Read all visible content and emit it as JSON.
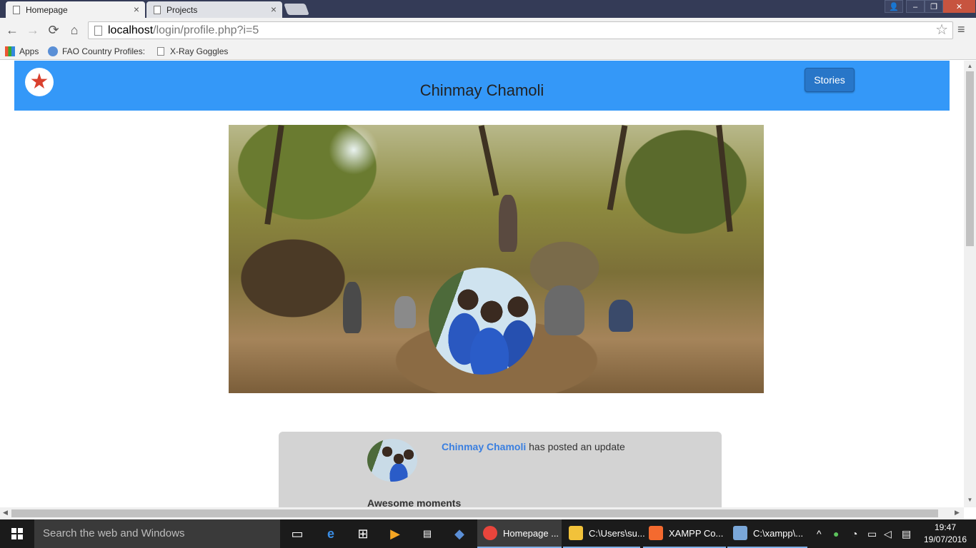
{
  "browser": {
    "tabs": [
      {
        "label": "Homepage",
        "close": "×"
      },
      {
        "label": "Projects",
        "close": "×"
      }
    ],
    "window_controls": {
      "user": "👤",
      "minimize": "–",
      "restore": "❐",
      "close": "✕"
    },
    "nav": {
      "back": "←",
      "forward": "→",
      "reload": "⟳",
      "home": "⌂"
    },
    "url": {
      "host": "localhost",
      "path": "/login/profile.php?i=5"
    },
    "star": "☆",
    "menu": "≡",
    "bookmarks": [
      {
        "label": "Apps",
        "icon": "apps-icon"
      },
      {
        "label": "FAO Country Profiles:",
        "icon": "globe-icon"
      },
      {
        "label": "X-Ray Goggles",
        "icon": "page-icon"
      }
    ]
  },
  "site": {
    "logo_glyph": "★",
    "title": "Chinmay Chamoli",
    "nav_button": "Stories"
  },
  "post": {
    "author": "Chinmay Chamoli",
    "action": "has posted an update",
    "title": "Awesome moments"
  },
  "scrollbars": {
    "up": "▲",
    "down": "▼",
    "left": "◀",
    "right": "▶"
  },
  "taskbar": {
    "search_placeholder": "Search the web and Windows",
    "apps": [
      {
        "label": "Homepage ...",
        "icon": "chrome-icon",
        "color": "#e8453c"
      },
      {
        "label": "C:\\Users\\su...",
        "icon": "folder-icon",
        "color": "#f2c23a"
      },
      {
        "label": "XAMPP Co...",
        "icon": "xampp-icon",
        "color": "#f46a2f"
      },
      {
        "label": "C:\\xampp\\...",
        "icon": "notepad-icon",
        "color": "#7aa7d8"
      }
    ],
    "tray": {
      "chevron": "^",
      "time": "19:47",
      "date": "19/07/2016"
    }
  }
}
